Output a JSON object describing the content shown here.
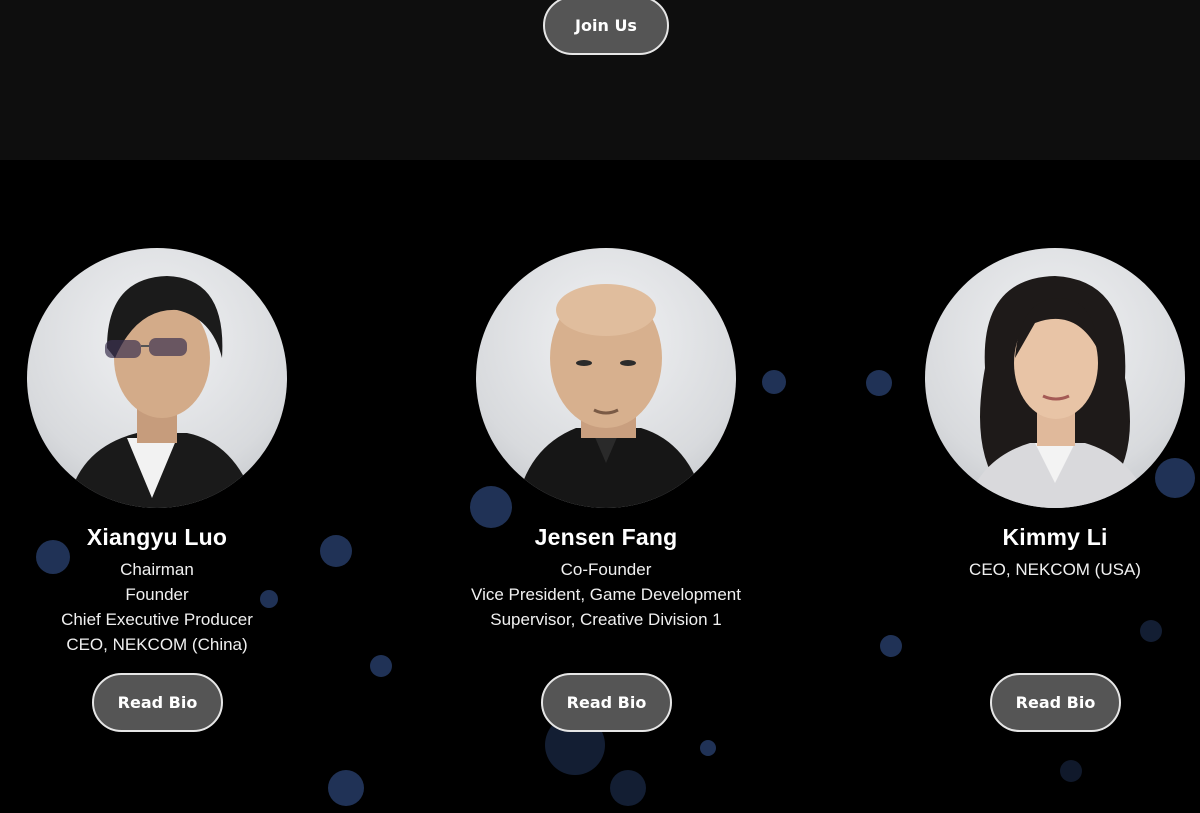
{
  "header": {
    "join_label": "Join Us"
  },
  "members": [
    {
      "name": "Xiangyu Luo",
      "roles": [
        "Chairman",
        "Founder",
        "Chief Executive Producer",
        "CEO, NEKCOM (China)"
      ],
      "button_label": "Read Bio"
    },
    {
      "name": "Jensen Fang",
      "roles": [
        "Co-Founder",
        "Vice President, Game Development",
        "Supervisor, Creative Division 1"
      ],
      "button_label": "Read Bio"
    },
    {
      "name": "Kimmy Li",
      "roles": [
        "CEO, NEKCOM (USA)"
      ],
      "button_label": "Read Bio"
    }
  ],
  "colors": {
    "background": "#000000",
    "top_band": "#0e0e0e",
    "button_fill": "#555555",
    "button_border": "#e6e6e6",
    "bokeh": "#466ebe"
  }
}
